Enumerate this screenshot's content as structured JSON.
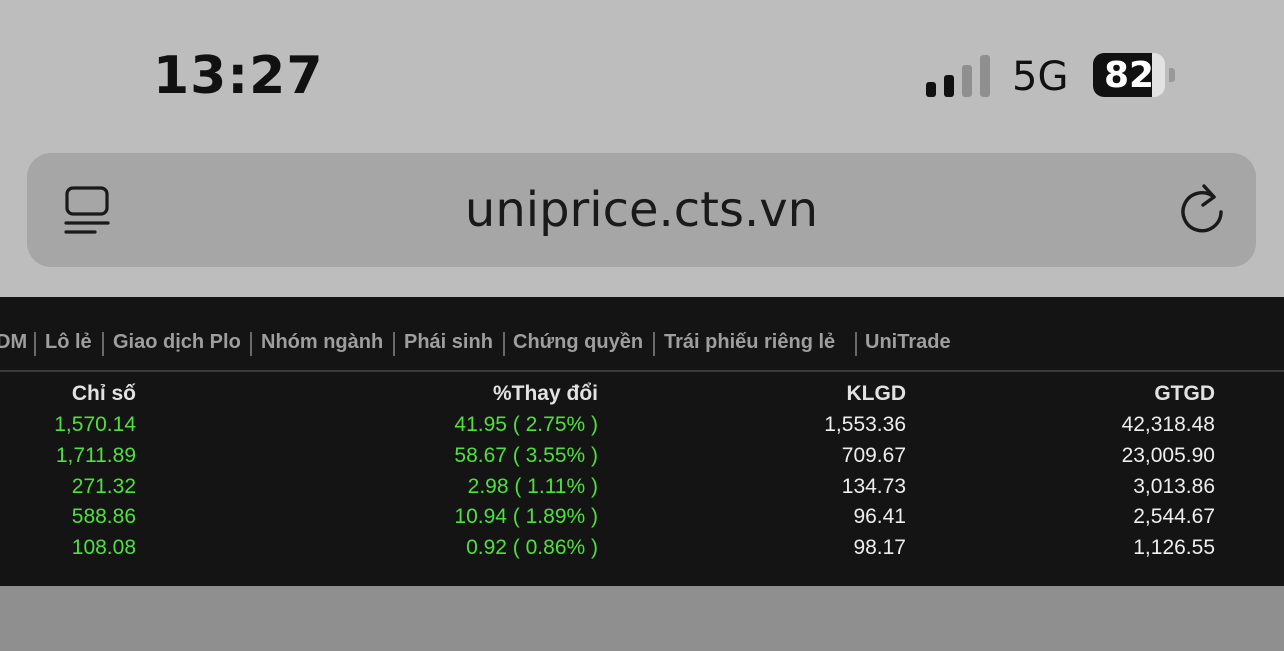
{
  "status_bar": {
    "time": "13:27",
    "network": "5G",
    "battery": "82",
    "battery_level": 0.82,
    "signal_bars_active": 2,
    "signal_bars_total": 4
  },
  "browser": {
    "url": "uniprice.cts.vn",
    "reader_icon": "reader-mode-icon",
    "reload_icon": "reload-icon"
  },
  "nav": {
    "tabs": [
      "DM",
      "Lô lẻ",
      "Giao dịch Plo",
      "Nhóm ngành",
      "Phái sinh",
      "Chứng quyền",
      "Trái phiếu riêng lẻ",
      "UniTrade"
    ]
  },
  "table": {
    "headers": [
      "Chỉ số",
      "%Thay đổi",
      "KLGD",
      "GTGD"
    ],
    "rows": [
      [
        "1,570.14",
        "41.95 ( 2.75% )",
        "1,553.36",
        "42,318.48"
      ],
      [
        "1,711.89",
        "58.67 ( 3.55% )",
        "709.67",
        "23,005.90"
      ],
      [
        "271.32",
        "2.98 ( 1.11% )",
        "134.73",
        "3,013.86"
      ],
      [
        "588.86",
        "10.94 ( 1.89% )",
        "96.41",
        "2,544.67"
      ],
      [
        "108.08",
        "0.92 ( 0.86% )",
        "98.17",
        "1,126.55"
      ]
    ]
  },
  "colors": {
    "up": "#4ee03c",
    "panel_bg": "#141414",
    "page_bg": "#bdbdbd"
  }
}
